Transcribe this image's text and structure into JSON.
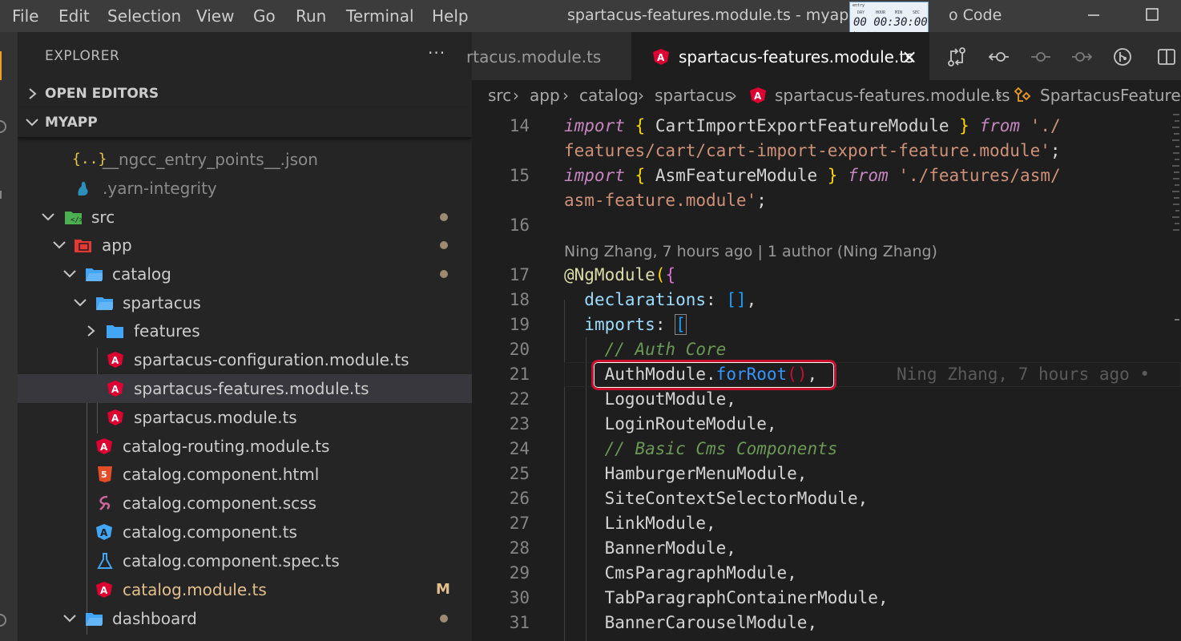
{
  "menu": [
    "File",
    "Edit",
    "Selection",
    "View",
    "Go",
    "Run",
    "Terminal",
    "Help"
  ],
  "window": {
    "title": "spartacus-features.module.ts - myapp - Visual Studio Code",
    "title_visible_left": "spartacus-features.module.ts - myapp - V",
    "title_visible_right": "o Code"
  },
  "timer": {
    "caption": "entry",
    "labels": [
      "DAY",
      "HOUR",
      "MIN",
      "SEC"
    ],
    "display": "00 00:30:00"
  },
  "sidebar": {
    "title": "EXPLORER",
    "more": "···",
    "open_editors": "OPEN EDITORS",
    "workspace": "MYAPP",
    "tree": [
      {
        "label": "__ngcc_entry_points__.json",
        "icon": "json-icon",
        "decorated": false,
        "badge": ""
      },
      {
        "label": ".yarn-integrity",
        "icon": "yarn-icon",
        "decorated": false,
        "badge": ""
      },
      {
        "label": "src",
        "icon": "folder-src-icon",
        "decorated": true,
        "badge": ""
      },
      {
        "label": "app",
        "icon": "folder-app-icon",
        "decorated": true,
        "badge": ""
      },
      {
        "label": "catalog",
        "icon": "folder-open-icon",
        "decorated": true,
        "badge": ""
      },
      {
        "label": "spartacus",
        "icon": "folder-open-icon",
        "decorated": false,
        "badge": ""
      },
      {
        "label": "features",
        "icon": "folder-icon",
        "decorated": false,
        "badge": ""
      },
      {
        "label": "spartacus-configuration.module.ts",
        "icon": "angular-icon",
        "decorated": false,
        "badge": ""
      },
      {
        "label": "spartacus-features.module.ts",
        "icon": "angular-icon",
        "decorated": false,
        "badge": ""
      },
      {
        "label": "spartacus.module.ts",
        "icon": "angular-icon",
        "decorated": false,
        "badge": ""
      },
      {
        "label": "catalog-routing.module.ts",
        "icon": "angular-icon",
        "decorated": false,
        "badge": ""
      },
      {
        "label": "catalog.component.html",
        "icon": "html-icon",
        "decorated": false,
        "badge": ""
      },
      {
        "label": "catalog.component.scss",
        "icon": "sass-icon",
        "decorated": false,
        "badge": ""
      },
      {
        "label": "catalog.component.ts",
        "icon": "angular-component-icon",
        "decorated": false,
        "badge": ""
      },
      {
        "label": "catalog.component.spec.ts",
        "icon": "test-flask-icon",
        "decorated": false,
        "badge": ""
      },
      {
        "label": "catalog.module.ts",
        "icon": "angular-icon",
        "decorated": false,
        "badge": "M"
      },
      {
        "label": "dashboard",
        "icon": "folder-open-icon",
        "decorated": true,
        "badge": ""
      }
    ]
  },
  "tabs": [
    {
      "label": "spartacus.module.ts",
      "visible": "rtacus.module.ts",
      "active": false
    },
    {
      "label": "spartacus-features.module.ts",
      "visible": "spartacus-features.module.ts",
      "active": true,
      "close": "×"
    }
  ],
  "breadcrumb": [
    "src",
    "app",
    "catalog",
    "spartacus",
    "spartacus-features.module.ts",
    "SpartacusFeaturesM"
  ],
  "editor": {
    "codelens": "Ning Zhang, 7 hours ago | 1 author (Ning Zhang)",
    "blame": "Ning Zhang, 7 hours ago •",
    "line_numbers": [
      "14",
      "15",
      "16",
      "17",
      "18",
      "19",
      "20",
      "21",
      "22",
      "23",
      "24",
      "25",
      "26",
      "27",
      "28",
      "29",
      "30",
      "31"
    ],
    "tokens": {
      "import": "import",
      "from": "from",
      "cart_module": "CartImportExportFeatureModule",
      "cart_path_1": "'./",
      "cart_path_2": "features/cart/cart-import-export-feature.module'",
      "asm_module": "AsmFeatureModule",
      "asm_path_1": "'./features/asm/",
      "asm_path_2": "asm-feature.module'",
      "ngmodule": "@NgModule",
      "declarations": "declarations",
      "imports_key": "imports",
      "comment_auth": "// Auth Core",
      "auth_module": "AuthModule",
      "for_root": "forRoot",
      "comment_basic": "// Basic Cms Components"
    },
    "modules": [
      "LogoutModule",
      "LoginRouteModule",
      "HamburgerMenuModule",
      "SiteContextSelectorModule",
      "LinkModule",
      "BannerModule",
      "CmsParagraphModule",
      "TabParagraphContainerModule",
      "BannerCarouselModule"
    ]
  },
  "colors": {
    "accent_highlight": "#c8102e",
    "angular": "#dd0031",
    "folder": "#42a5f5",
    "modified_badge": "#e2c08d"
  }
}
